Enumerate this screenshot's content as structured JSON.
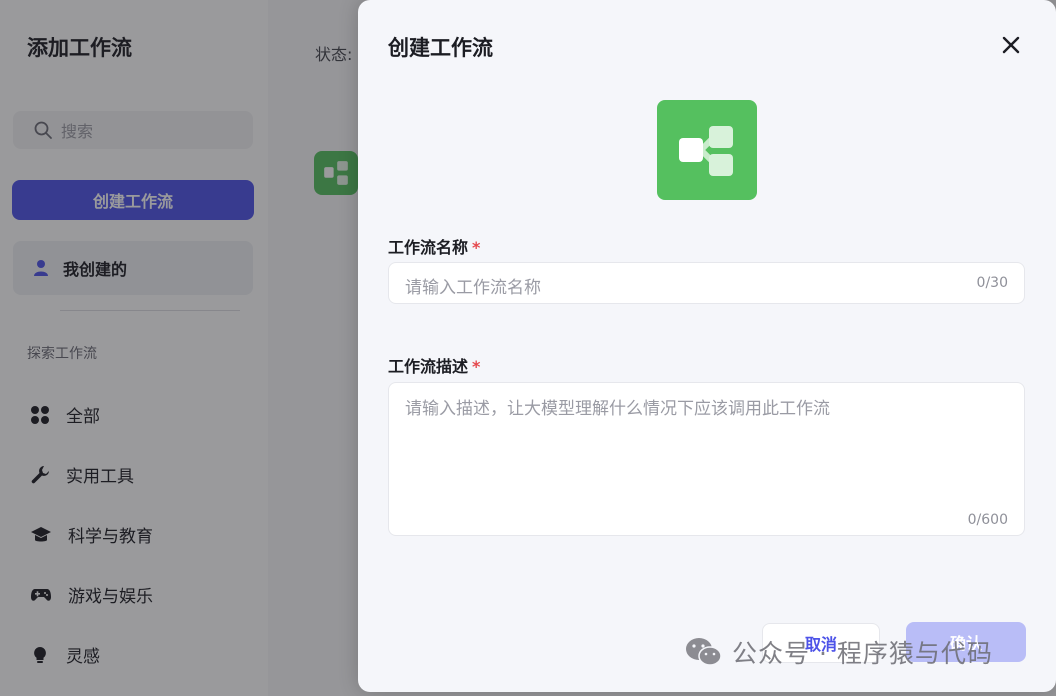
{
  "sidebar": {
    "title": "添加工作流",
    "search_placeholder": "搜索",
    "create_button": "创建工作流",
    "mine_label": "我创建的",
    "section_title": "探索工作流",
    "items": [
      {
        "label": "全部",
        "icon": "grid-icon"
      },
      {
        "label": "实用工具",
        "icon": "wrench-icon"
      },
      {
        "label": "科学与教育",
        "icon": "graduation-cap-icon"
      },
      {
        "label": "游戏与娱乐",
        "icon": "gamepad-icon"
      },
      {
        "label": "灵感",
        "icon": "lightbulb-icon"
      }
    ]
  },
  "main": {
    "status_label": "状态:"
  },
  "modal": {
    "title": "创建工作流",
    "name_label": "工作流名称",
    "name_placeholder": "请输入工作流名称",
    "name_counter": "0/30",
    "desc_label": "工作流描述",
    "desc_placeholder": "请输入描述，让大模型理解什么情况下应该调用此工作流",
    "desc_counter": "0/600",
    "required_mark": "*",
    "cancel_label": "取消",
    "confirm_label": "确认"
  },
  "watermark": {
    "text": "公众号 · 程序猿与代码"
  },
  "colors": {
    "accent": "#4d53e8",
    "workflow_green": "#55c05f",
    "required": "#e5484d"
  }
}
